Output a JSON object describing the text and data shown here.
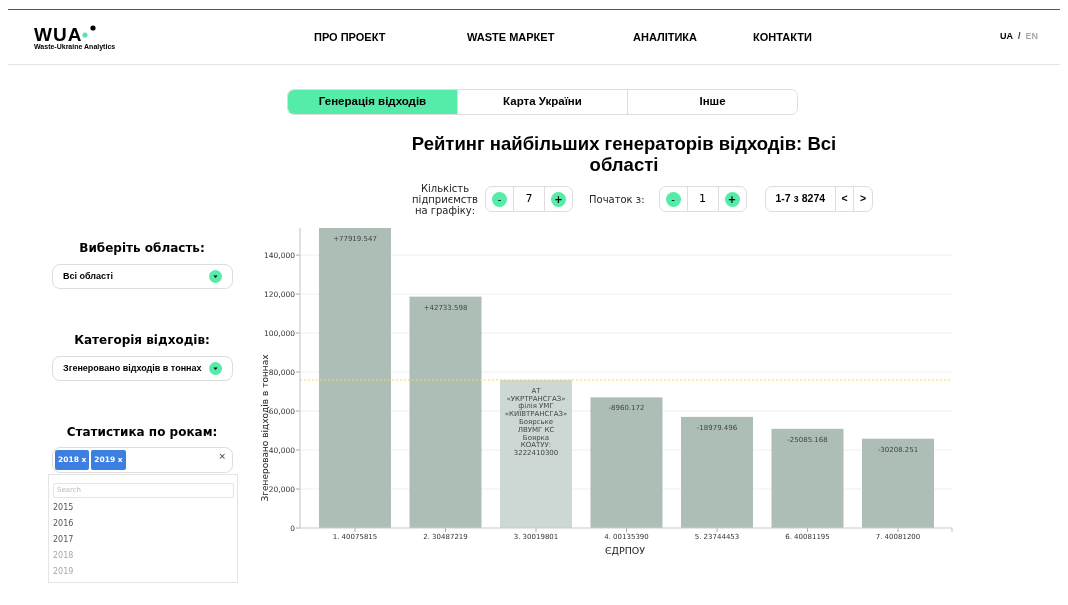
{
  "header": {
    "logo": {
      "text": "WUA",
      "subtitle": "Waste-Ukraine Analytics"
    },
    "nav": [
      {
        "label": "ПРО ПРОЕКТ"
      },
      {
        "label": "WASTE МАРКЕТ"
      },
      {
        "label": "АНАЛІТИКА"
      },
      {
        "label": "КОНТАКТИ"
      }
    ],
    "languages": [
      {
        "label": "UA",
        "selected": true
      },
      {
        "label": "EN",
        "selected": false
      }
    ],
    "language_separator": "/"
  },
  "tabs": [
    {
      "label": "Генерація відходів",
      "selected": true
    },
    {
      "label": "Карта України",
      "selected": false
    },
    {
      "label": "Інше",
      "selected": false
    }
  ],
  "title": "Рейтинг найбільших генераторів відходів: Всі області",
  "controls": {
    "count": {
      "label": "Кількість підприємств на графіку:",
      "minus": "-",
      "value": "7",
      "plus": "+"
    },
    "start": {
      "label": "Початок з:",
      "minus": "-",
      "value": "1",
      "plus": "+"
    },
    "pager": {
      "range": "1-7 з 8274",
      "prev": "<",
      "next": ">"
    }
  },
  "sidebar": {
    "region": {
      "label": "Виберіть область:",
      "value": "Всі області"
    },
    "category": {
      "label": "Категорія відходів:",
      "value": "Згенеровано відходів в тоннах"
    },
    "years": {
      "label": "Статистика по рокам:",
      "chips": [
        {
          "label": "2018 x"
        },
        {
          "label": "2019 x"
        }
      ],
      "clear": "×",
      "search": {
        "placeholder": "Search"
      },
      "options": [
        {
          "label": "2015",
          "disabled": false
        },
        {
          "label": "2016",
          "disabled": false
        },
        {
          "label": "2017",
          "disabled": false
        },
        {
          "label": "2018",
          "disabled": true
        },
        {
          "label": "2019",
          "disabled": true
        }
      ]
    }
  },
  "chart_data": {
    "type": "bar",
    "xlabel": "ЄДРПОУ",
    "ylabel": "Згенеровано відходів в тоннах",
    "categories": [
      "1. 40075815",
      "2. 30487219",
      "3. 30019801",
      "4. 00135390",
      "5. 23744453",
      "6. 40081195",
      "7. 40081200"
    ],
    "values": [
      153900,
      118700,
      76000,
      67000,
      57000,
      50900,
      45800
    ],
    "ylim": [
      0,
      153900
    ],
    "grid": true,
    "yticks": [
      {
        "value": 0,
        "label": "0"
      },
      {
        "value": 20000,
        "label": "20,000"
      },
      {
        "value": 40000,
        "label": "40,000"
      },
      {
        "value": 60000,
        "label": "60,000"
      },
      {
        "value": 80000,
        "label": "80,000"
      },
      {
        "value": 100000,
        "label": "100,000"
      },
      {
        "value": 120000,
        "label": "120,000"
      },
      {
        "value": 140000,
        "label": "140,000"
      }
    ],
    "ref_lines": [
      {
        "axis": "y",
        "value": 76000
      }
    ]
  },
  "bar_labels": [
    {
      "text": "+77919.547",
      "hovered": false
    },
    {
      "text": "+42733.598",
      "hovered": false
    },
    {
      "text": "АТ\n«УКРТРАНСГАЗ»\nфілія УМГ\n«КИЇВТРАНСГАЗ»\nБоярське\nЛВУМГ КС\nБоярка\nКОАТУУ:\n3222410300",
      "hovered": true
    },
    {
      "text": "-8960.172",
      "hovered": false
    },
    {
      "text": "-18979.496",
      "hovered": false
    },
    {
      "text": "-25085.168",
      "hovered": false
    },
    {
      "text": "-30208.251",
      "hovered": false
    }
  ]
}
